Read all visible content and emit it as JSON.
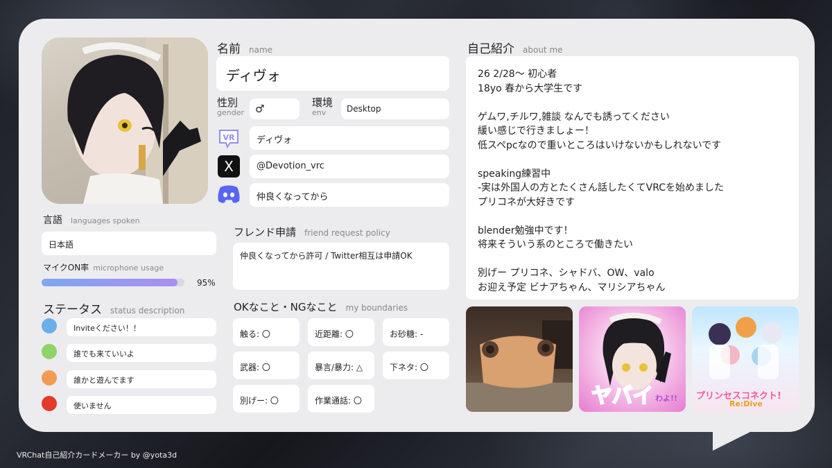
{
  "name": {
    "label_jp": "名前",
    "label_en": "name",
    "value": "ディヴォ"
  },
  "gender": {
    "label_jp": "性別",
    "label_en": "gender",
    "value": "♂"
  },
  "env": {
    "label_jp": "環境",
    "label_en": "env",
    "value": "Desktop"
  },
  "accounts": {
    "vrchat": "ディヴォ",
    "x": "@Devotion_vrc",
    "discord": "仲良くなってから"
  },
  "languages": {
    "label_jp": "言語",
    "label_en": "languages spoken",
    "value": "日本語"
  },
  "mic": {
    "label_jp": "マイクON率",
    "label_en": "microphone usage",
    "percent_text": "95%",
    "percent": 95
  },
  "friend": {
    "label_jp": "フレンド申請",
    "label_en": "friend request policy",
    "value": "仲良くなってから許可 / Twitter相互は申請OK"
  },
  "status": {
    "label_jp": "ステータス",
    "label_en": "status description",
    "items": [
      {
        "color": "#6ab0e8",
        "text": "Inviteください！！"
      },
      {
        "color": "#8fd36a",
        "text": "誰でも来ていいよ"
      },
      {
        "color": "#f09a52",
        "text": "誰かと遊んでます"
      },
      {
        "color": "#e43a2c",
        "text": "使いません"
      }
    ]
  },
  "boundaries": {
    "label_jp": "OKなこと・NGなこと",
    "label_en": "my boundaries",
    "items": [
      "触る: 〇",
      "近距離: 〇",
      "お砂糖: -",
      "武器: 〇",
      "暴言/暴力: △",
      "下ネタ: 〇",
      "別げー: 〇",
      "作業通話: 〇"
    ]
  },
  "about": {
    "label_jp": "自己紹介",
    "label_en": "about me",
    "lines": [
      "26 2/28～ 初心者",
      "18yo 春から大学生です",
      "",
      "ゲムワ,チルワ,雑談 なんでも誘ってください",
      "緩い感じで行きましょー！",
      "低スペpcなので重いところはいけないかもしれないです",
      "",
      "speaking練習中",
      "-実は外国人の方とたくさん話したくてVRCを始めました",
      "プリコネが大好きです",
      "",
      "blender勉強中です！",
      "将来そういう系のところで働きたい",
      "",
      "別げー プリコネ、シャドバ、OW、valo",
      "お迎え予定 ビナアちゃん、マリシアちゃん"
    ]
  },
  "thumbs": {
    "t2_text": "ヤバイ",
    "t2_small": "わよ!!",
    "t3_title": "プリンセスコネクト!",
    "t3_sub": "Re:Dive"
  },
  "icons": {
    "vr": "VR",
    "x": "X"
  },
  "colors": {
    "accent": "#8e8ff0",
    "discord": "#5865f2"
  },
  "footer": "VRChat自己紹介カードメーカー by @yota3d"
}
